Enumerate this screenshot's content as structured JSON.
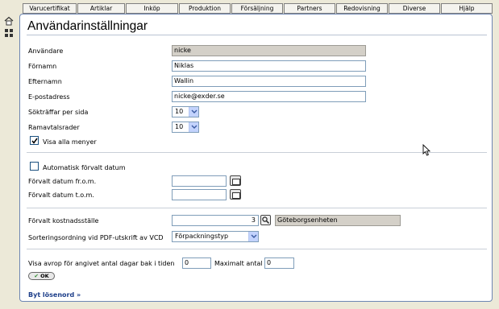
{
  "menu": {
    "items": [
      "Varucertifikat",
      "Artiklar",
      "Inköp",
      "Produktion",
      "Försäljning",
      "Partners",
      "Redovisning",
      "Diverse",
      "Hjälp"
    ]
  },
  "page": {
    "title": "Användarinställningar"
  },
  "form": {
    "user_label": "Användare",
    "user_value": "nicke",
    "firstname_label": "Förnamn",
    "firstname_value": "Niklas",
    "lastname_label": "Efternamn",
    "lastname_value": "Wallin",
    "email_label": "E-postadress",
    "email_value": "nicke@exder.se",
    "hits_label": "Sökträffar per sida",
    "hits_value": "10",
    "contract_label": "Ramavtalsrader",
    "contract_value": "10",
    "show_menus_label": "Visa alla menyer",
    "show_menus_checked": true,
    "auto_date_label": "Automatisk förvalt datum",
    "auto_date_checked": false,
    "date_from_label": "Förvalt datum fr.o.m.",
    "date_from_value": "",
    "date_to_label": "Förvalt datum t.o.m.",
    "date_to_value": "",
    "cost_center_label": "Förvalt kostnadsställe",
    "cost_center_code": "3",
    "cost_center_name": "Göteborgsenheten",
    "pdf_sort_label": "Sorteringsordning vid PDF-utskrift av VCD",
    "pdf_sort_value": "Förpackningstyp",
    "avrop_label": "Visa avrop för angivet antal dagar bak i tiden",
    "avrop_days": "0",
    "max_label": "Maximalt antal",
    "max_value": "0",
    "ok_label": "OK"
  },
  "links": {
    "change_password": "Byt lösenord »"
  },
  "icons": {
    "home": "home-icon",
    "grid": "grid-icon",
    "calendar": "calendar-icon",
    "search": "search-icon",
    "cursor": "mouse-cursor-icon"
  }
}
